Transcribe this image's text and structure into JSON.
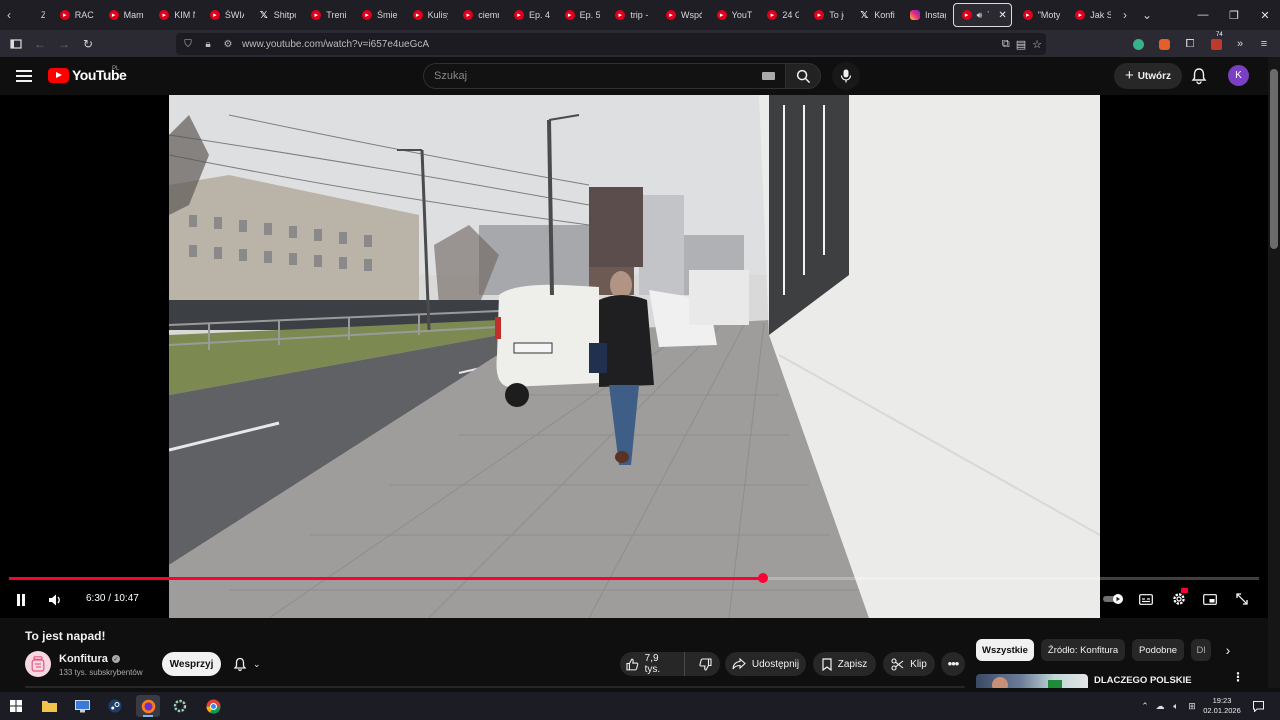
{
  "browser": {
    "tabs": [
      {
        "label": "ZM",
        "favicon": "tab-favicon-generic",
        "active": false
      },
      {
        "label": "RACH",
        "favicon": "youtube-icon",
        "active": false
      },
      {
        "label": "Mama",
        "favicon": "youtube-icon",
        "active": false
      },
      {
        "label": "KIM N",
        "favicon": "youtube-icon",
        "active": false
      },
      {
        "label": "ŚWIĄ",
        "favicon": "youtube-icon",
        "active": false
      },
      {
        "label": "Shitpo",
        "favicon": "x-icon",
        "active": false
      },
      {
        "label": "Trenin",
        "favicon": "youtube-icon",
        "active": false
      },
      {
        "label": "Śmier",
        "favicon": "youtube-icon",
        "active": false
      },
      {
        "label": "Kulisy",
        "favicon": "youtube-icon",
        "active": false
      },
      {
        "label": "ciemn",
        "favicon": "youtube-icon",
        "active": false
      },
      {
        "label": "Ep. 4",
        "favicon": "youtube-icon",
        "active": false
      },
      {
        "label": "Ep. 5",
        "favicon": "youtube-icon",
        "active": false
      },
      {
        "label": "trip -",
        "favicon": "youtube-icon",
        "active": false
      },
      {
        "label": "Wspó",
        "favicon": "youtube-icon",
        "active": false
      },
      {
        "label": "YouTu",
        "favicon": "youtube-icon",
        "active": false
      },
      {
        "label": "24 Go",
        "favicon": "youtube-icon",
        "active": false
      },
      {
        "label": "To jes",
        "favicon": "youtube-icon",
        "active": false
      },
      {
        "label": "Konfit",
        "favicon": "x-icon",
        "active": false
      },
      {
        "label": "Instag",
        "favicon": "instagram-icon",
        "active": false
      },
      {
        "label": "To j",
        "favicon": "youtube-icon",
        "active": true
      },
      {
        "label": "\"Moty",
        "favicon": "youtube-icon",
        "active": false
      },
      {
        "label": "Jak Sł",
        "favicon": "youtube-icon",
        "active": false
      }
    ],
    "url": "www.youtube.com/watch?v=i657e4ueGcA",
    "extension_badge": "74"
  },
  "youtube": {
    "logo_text": "YouTube",
    "country_code": "PL",
    "search_placeholder": "Szukaj",
    "create_label": "Utwórz",
    "avatar_letter": "K"
  },
  "player": {
    "current_time": "6:30",
    "separator": " / ",
    "duration": "10:47",
    "progress_fraction": 0.6034,
    "state": "playing"
  },
  "video": {
    "title": "To jest napad!",
    "channel": "Konfitura",
    "subscribers": "133 tys. subskrybentów",
    "support_label": "Wesprzyj",
    "likes": "7,9 tys.",
    "share_label": "Udostępnij",
    "save_label": "Zapisz",
    "clip_label": "Klip"
  },
  "chips": [
    {
      "label": "Wszystkie",
      "active": true
    },
    {
      "label": "Źródło: Konfitura",
      "active": false
    },
    {
      "label": "Podobne",
      "active": false
    },
    {
      "label": "Dl",
      "active": false
    }
  ],
  "recommendation": {
    "title": "DLACZEGO POLSKIE MIASTA SĄ BRZYDKIE?"
  },
  "taskbar": {
    "time": "19:23",
    "date": "02.01.2026"
  }
}
